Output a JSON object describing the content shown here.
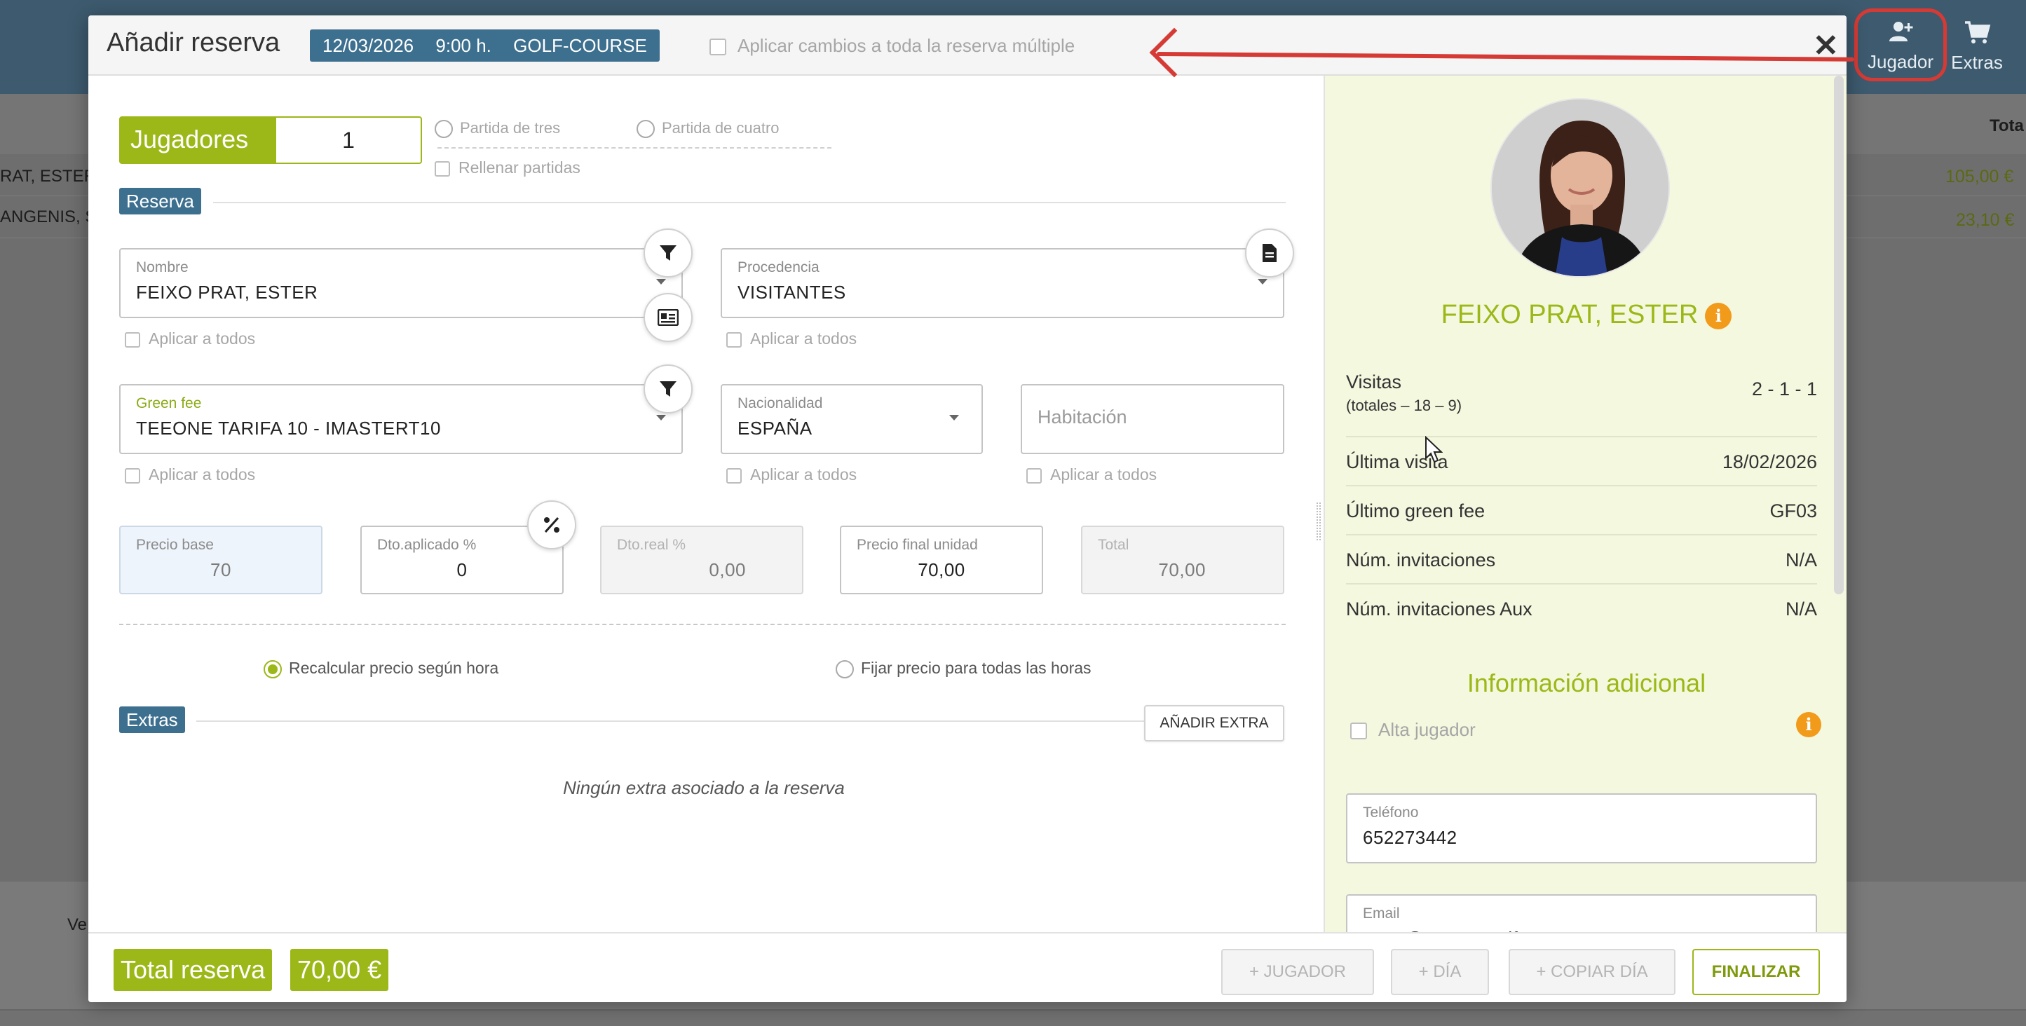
{
  "header": {
    "buttons": [
      {
        "label": "Jugador",
        "icon": "add-user-icon"
      },
      {
        "label": "Extras",
        "icon": "cart-icon"
      }
    ]
  },
  "background": {
    "col_header_total": "Tota",
    "rows": [
      {
        "name": "RAT, ESTER",
        "amount": "105,00 €"
      },
      {
        "name": "ANGENIS, SE",
        "amount": "23,10 €"
      }
    ],
    "bottom_label": "Ve"
  },
  "modal": {
    "title": "Añadir reserva",
    "chip": {
      "date": "12/03/2026",
      "time": "9:00 h.",
      "course": "GOLF-COURSE"
    },
    "apply_multi_label": "Aplicar cambios a toda la reserva múltiple",
    "close_label": "✕"
  },
  "jugadores": {
    "label": "Jugadores",
    "value": "1",
    "options": [
      "Partida de tres",
      "Partida de cuatro"
    ],
    "rellenar": "Rellenar partidas"
  },
  "reserva": {
    "section_label": "Reserva",
    "nombre": {
      "label": "Nombre",
      "value": "FEIXO PRAT, ESTER"
    },
    "procedencia": {
      "label": "Procedencia",
      "value": "VISITANTES"
    },
    "green_fee": {
      "label": "Green fee",
      "value": "TEEONE TARIFA 10 - IMASTERT10"
    },
    "nacionalidad": {
      "label": "Nacionalidad",
      "value": "ESPAÑA"
    },
    "habitacion": {
      "placeholder": "Habitación"
    },
    "apply_all": "Aplicar a todos"
  },
  "precios": {
    "base": {
      "label": "Precio base",
      "value": "70"
    },
    "dto_aplicado": {
      "label": "Dto.aplicado %",
      "value": "0"
    },
    "dto_real": {
      "label": "Dto.real %",
      "value": "0,00"
    },
    "final_unidad": {
      "label": "Precio final unidad",
      "value": "70,00"
    },
    "total": {
      "label": "Total",
      "value": "70,00"
    }
  },
  "recalc": {
    "opt1": "Recalcular precio según hora",
    "opt2": "Fijar precio para todas las horas"
  },
  "extras": {
    "section_label": "Extras",
    "add_button": "AÑADIR EXTRA",
    "empty": "Ningún extra asociado a la reserva"
  },
  "player": {
    "name": "FEIXO PRAT, ESTER",
    "stats": [
      {
        "label": "Visitas",
        "sub": "(totales – 18 – 9)",
        "value": "2 - 1 - 1"
      },
      {
        "label": "Última visita",
        "value": "18/02/2026"
      },
      {
        "label": "Último green fee",
        "value": "GF03"
      },
      {
        "label": "Núm. invitaciones",
        "value": "N/A"
      },
      {
        "label": "Núm. invitaciones Aux",
        "value": "N/A"
      }
    ],
    "info_title": "Información adicional",
    "alta_label": "Alta jugador",
    "telefono": {
      "label": "Teléfono",
      "value": "652273442"
    },
    "email": {
      "label": "Email",
      "value": "ester@teeone.golf"
    }
  },
  "footer": {
    "total_label": "Total reserva",
    "total_value": "70,00 €",
    "btn_jugador": "+ JUGADOR",
    "btn_dia": "+ DÍA",
    "btn_copiar": "+ COPIAR DÍA",
    "btn_finalizar": "FINALIZAR"
  },
  "colors": {
    "accent_green": "#9cb818",
    "chip_blue": "#3d6f8f",
    "header_bg": "#3d5a6e",
    "annotation_red": "#d63a35",
    "info_orange": "#f29a1a"
  }
}
